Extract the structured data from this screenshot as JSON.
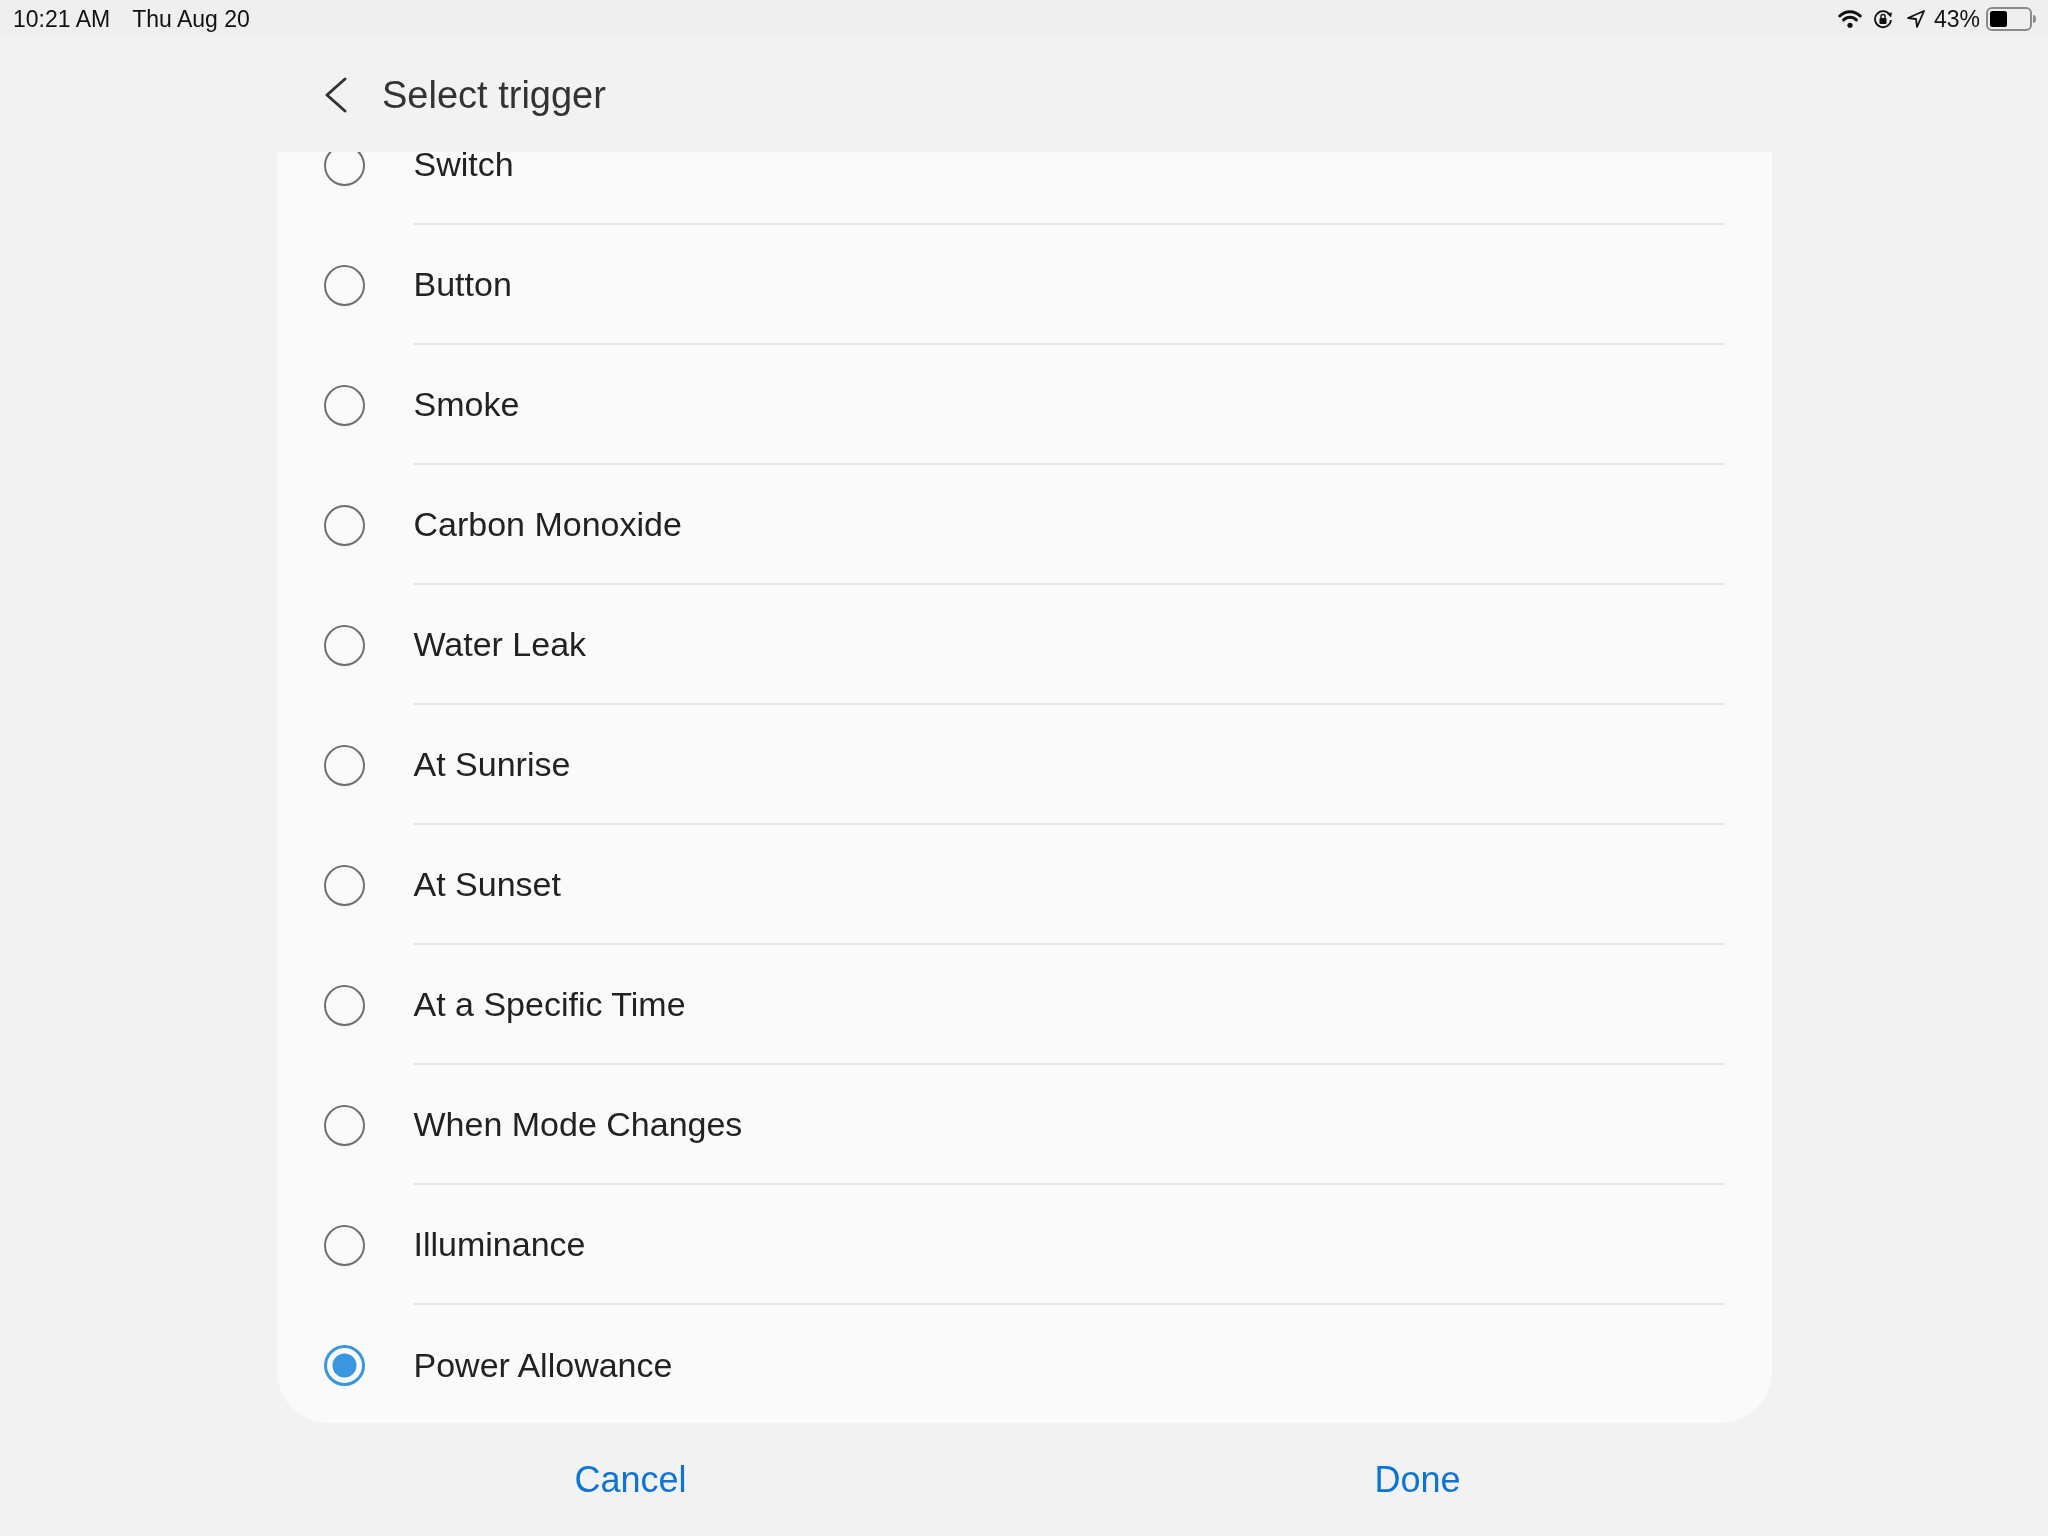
{
  "status_bar": {
    "time": "10:21 AM",
    "date": "Thu Aug 20",
    "battery_percent": "43%"
  },
  "header": {
    "title": "Select trigger"
  },
  "triggers": [
    {
      "label": "Switch",
      "selected": false
    },
    {
      "label": "Button",
      "selected": false
    },
    {
      "label": "Smoke",
      "selected": false
    },
    {
      "label": "Carbon Monoxide",
      "selected": false
    },
    {
      "label": "Water Leak",
      "selected": false
    },
    {
      "label": "At Sunrise",
      "selected": false
    },
    {
      "label": "At Sunset",
      "selected": false
    },
    {
      "label": "At a Specific Time",
      "selected": false
    },
    {
      "label": "When Mode Changes",
      "selected": false
    },
    {
      "label": "Illuminance",
      "selected": false
    },
    {
      "label": "Power Allowance",
      "selected": true
    }
  ],
  "buttons": [
    {
      "label": "Cancel"
    },
    {
      "label": "Done"
    }
  ]
}
